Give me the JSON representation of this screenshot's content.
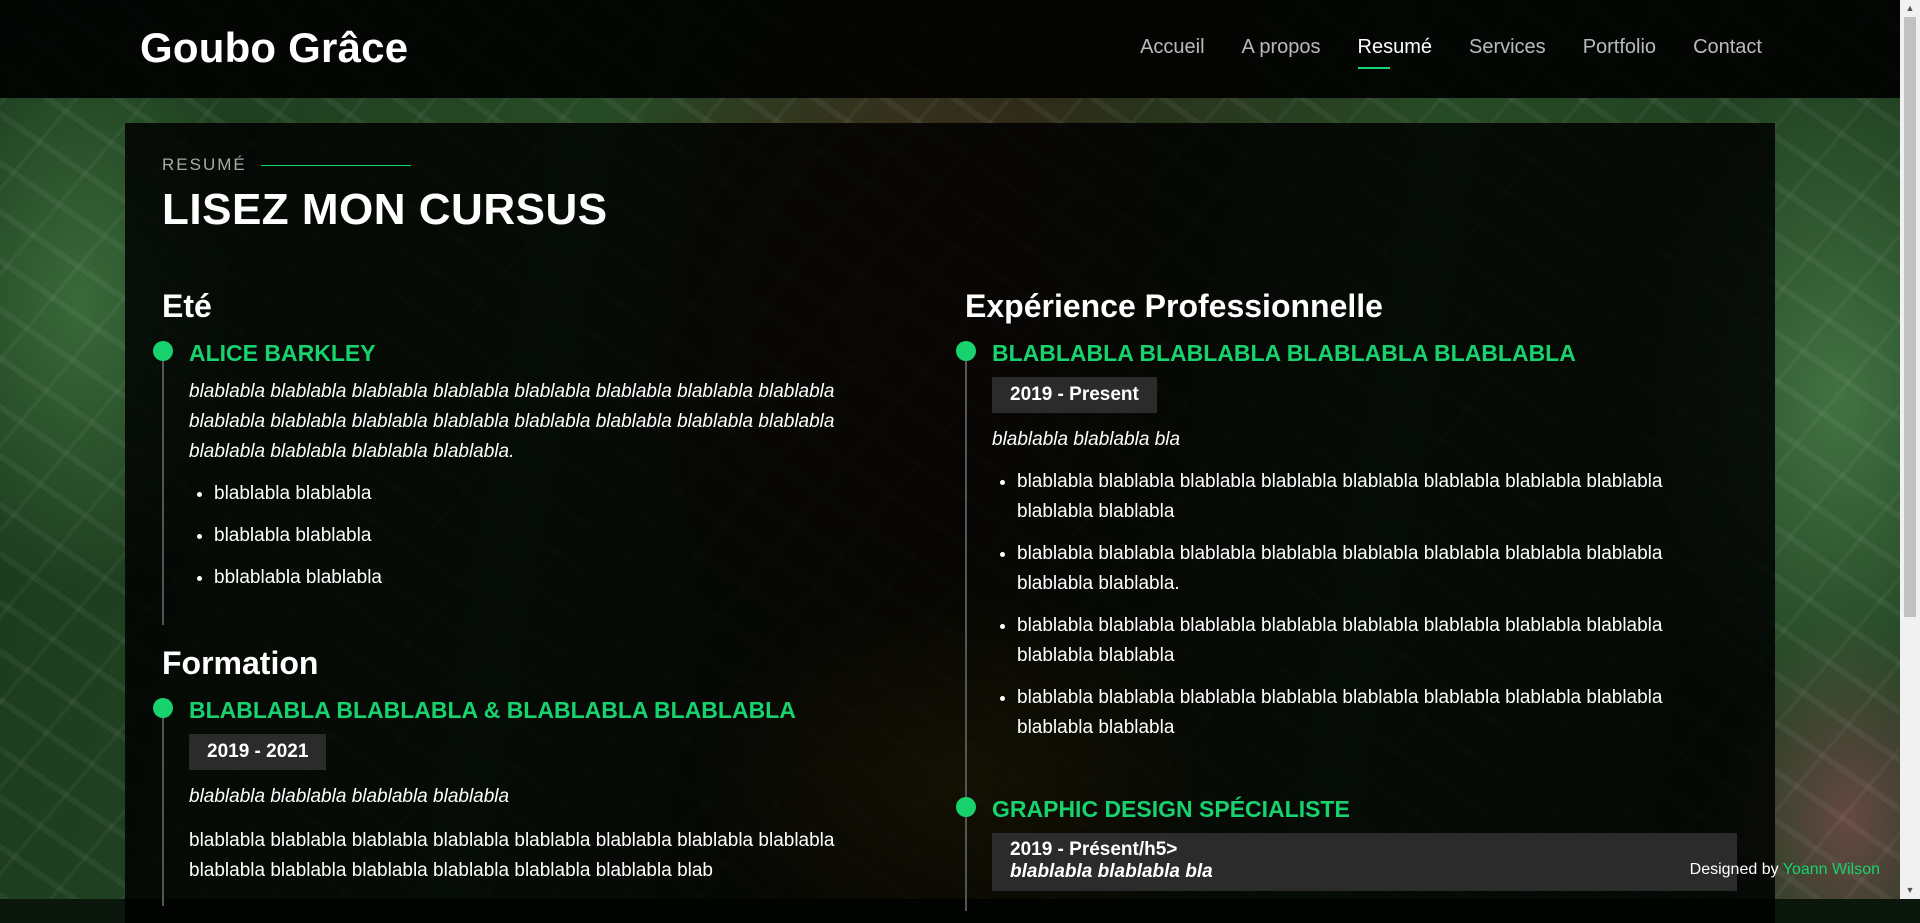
{
  "brand": {
    "name": "Goubo Grâce"
  },
  "nav": {
    "items": [
      {
        "label": "Accueil"
      },
      {
        "label": "A propos"
      },
      {
        "label": "Resumé",
        "active": true
      },
      {
        "label": "Services"
      },
      {
        "label": "Portfolio"
      },
      {
        "label": "Contact"
      }
    ]
  },
  "section": {
    "label": "RESUMÉ",
    "title": "LISEZ MON CURSUS"
  },
  "left": {
    "summary": {
      "heading": "Eté",
      "item_title": "ALICE BARKLEY",
      "text": "blablabla blablabla blablabla blablabla blablabla blablabla blablabla blablabla blablabla blablabla blablabla blablabla blablabla blablabla blablabla blablabla blablabla blablabla blablabla blablabla.",
      "bullets": [
        "blablabla blablabla",
        "blablabla blablabla",
        "bblablabla blablabla"
      ]
    },
    "education": {
      "heading": "Formation",
      "item_title": "BLABLABLA BLABLABLA & BLABLABLA BLABLABLA",
      "date": "2019 - 2021",
      "subtitle": "blablabla blablabla blablabla blablabla",
      "text": "blablabla blablabla blablabla blablabla blablabla blablabla blablabla blablabla blablabla blablabla blablabla blablabla blablabla blablabla blab"
    }
  },
  "right": {
    "heading": "Expérience Professionnelle",
    "job1": {
      "title": "BLABLABLA BLABLABLA BLABLABLA BLABLABLA",
      "date": "2019 - Present",
      "subtitle": "blablabla blablabla bla",
      "bullets": [
        "blablabla blablabla blablabla blablabla blablabla blablabla blablabla blablabla blablabla blablabla",
        "blablabla blablabla blablabla blablabla blablabla blablabla blablabla blablabla blablabla blablabla.",
        "blablabla blablabla blablabla blablabla blablabla blablabla blablabla blablabla blablabla blablabla",
        "blablabla blablabla blablabla blablabla blablabla blablabla blablabla blablabla blablabla blablabla"
      ]
    },
    "job2": {
      "title": "GRAPHIC DESIGN SPÉCIALISTE",
      "date": "2019 - Présent/h5>",
      "subtitle": "blablabla blablabla bla"
    }
  },
  "credit": {
    "prefix": "Designed by",
    "author": "Yoann Wilson"
  },
  "colors": {
    "accent": "#18d26e",
    "panel": "#000000",
    "date_badge": "#2b2b2b"
  }
}
